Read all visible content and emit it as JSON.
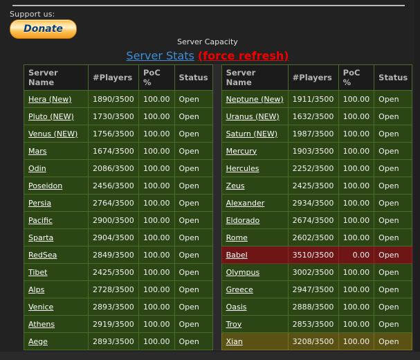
{
  "support": {
    "label": "Support us:",
    "donate_label": "Donate"
  },
  "titles": {
    "capacity": "Server Capacity",
    "stats_link": "Server Stats",
    "refresh_link": "(force refresh)"
  },
  "colors": {
    "page_background": "#222222",
    "row_normal": "#2c4515",
    "row_full": "#6e1515",
    "row_warning": "#5a5214",
    "header_background": "#1b1b1b",
    "border": "#4c6a2a",
    "link_blue": "#3f8fd8",
    "link_red": "#f00000",
    "donate_orange": "#f59a1e"
  },
  "columns": [
    "Server Name",
    "#Players",
    "PoC %",
    "Status"
  ],
  "left_table": [
    {
      "name": "Hera (New)",
      "players": "1890/3500",
      "poc": "100.00",
      "status": "Open",
      "state": "row-green"
    },
    {
      "name": "Pluto (NEW)",
      "players": "1730/3500",
      "poc": "100.00",
      "status": "Open",
      "state": "row-green"
    },
    {
      "name": "Venus (NEW)",
      "players": "1756/3500",
      "poc": "100.00",
      "status": "Open",
      "state": "row-green"
    },
    {
      "name": "Mars",
      "players": "1674/3500",
      "poc": "100.00",
      "status": "Open",
      "state": "row-green"
    },
    {
      "name": "Odin",
      "players": "2086/3500",
      "poc": "100.00",
      "status": "Open",
      "state": "row-green"
    },
    {
      "name": "Poseidon",
      "players": "2456/3500",
      "poc": "100.00",
      "status": "Open",
      "state": "row-green"
    },
    {
      "name": "Persia",
      "players": "2764/3500",
      "poc": "100.00",
      "status": "Open",
      "state": "row-green"
    },
    {
      "name": "Pacific",
      "players": "2900/3500",
      "poc": "100.00",
      "status": "Open",
      "state": "row-green"
    },
    {
      "name": "Sparta",
      "players": "2904/3500",
      "poc": "100.00",
      "status": "Open",
      "state": "row-green"
    },
    {
      "name": "RedSea",
      "players": "2849/3500",
      "poc": "100.00",
      "status": "Open",
      "state": "row-green"
    },
    {
      "name": "Tibet",
      "players": "2425/3500",
      "poc": "100.00",
      "status": "Open",
      "state": "row-green"
    },
    {
      "name": "Alps",
      "players": "2728/3500",
      "poc": "100.00",
      "status": "Open",
      "state": "row-green"
    },
    {
      "name": "Venice",
      "players": "2893/3500",
      "poc": "100.00",
      "status": "Open",
      "state": "row-green"
    },
    {
      "name": "Athens",
      "players": "2919/3500",
      "poc": "100.00",
      "status": "Open",
      "state": "row-green"
    },
    {
      "name": "Aege",
      "players": "2893/3500",
      "poc": "100.00",
      "status": "Open",
      "state": "row-green"
    }
  ],
  "right_table": [
    {
      "name": "Neptune (New)",
      "players": "1911/3500",
      "poc": "100.00",
      "status": "Open",
      "state": "row-green"
    },
    {
      "name": "Uranus (NEW)",
      "players": "1632/3500",
      "poc": "100.00",
      "status": "Open",
      "state": "row-green"
    },
    {
      "name": "Saturn (NEW)",
      "players": "1987/3500",
      "poc": "100.00",
      "status": "Open",
      "state": "row-green"
    },
    {
      "name": "Mercury",
      "players": "1903/3500",
      "poc": "100.00",
      "status": "Open",
      "state": "row-green"
    },
    {
      "name": "Hercules",
      "players": "2252/3500",
      "poc": "100.00",
      "status": "Open",
      "state": "row-green"
    },
    {
      "name": "Zeus",
      "players": "2425/3500",
      "poc": "100.00",
      "status": "Open",
      "state": "row-green"
    },
    {
      "name": "Alexander",
      "players": "2934/3500",
      "poc": "100.00",
      "status": "Open",
      "state": "row-green"
    },
    {
      "name": "Eldorado",
      "players": "2674/3500",
      "poc": "100.00",
      "status": "Open",
      "state": "row-green"
    },
    {
      "name": "Rome",
      "players": "2602/3500",
      "poc": "100.00",
      "status": "Open",
      "state": "row-green"
    },
    {
      "name": "Babel",
      "players": "3510/3500",
      "poc": "0.00",
      "status": "Open",
      "state": "row-red"
    },
    {
      "name": "Olympus",
      "players": "3002/3500",
      "poc": "100.00",
      "status": "Open",
      "state": "row-green"
    },
    {
      "name": "Greece",
      "players": "2947/3500",
      "poc": "100.00",
      "status": "Open",
      "state": "row-green"
    },
    {
      "name": "Oasis",
      "players": "2888/3500",
      "poc": "100.00",
      "status": "Open",
      "state": "row-green"
    },
    {
      "name": "Troy",
      "players": "2853/3500",
      "poc": "100.00",
      "status": "Open",
      "state": "row-green"
    },
    {
      "name": "Xian",
      "players": "3208/3500",
      "poc": "100.00",
      "status": "Open",
      "state": "row-gold"
    }
  ]
}
